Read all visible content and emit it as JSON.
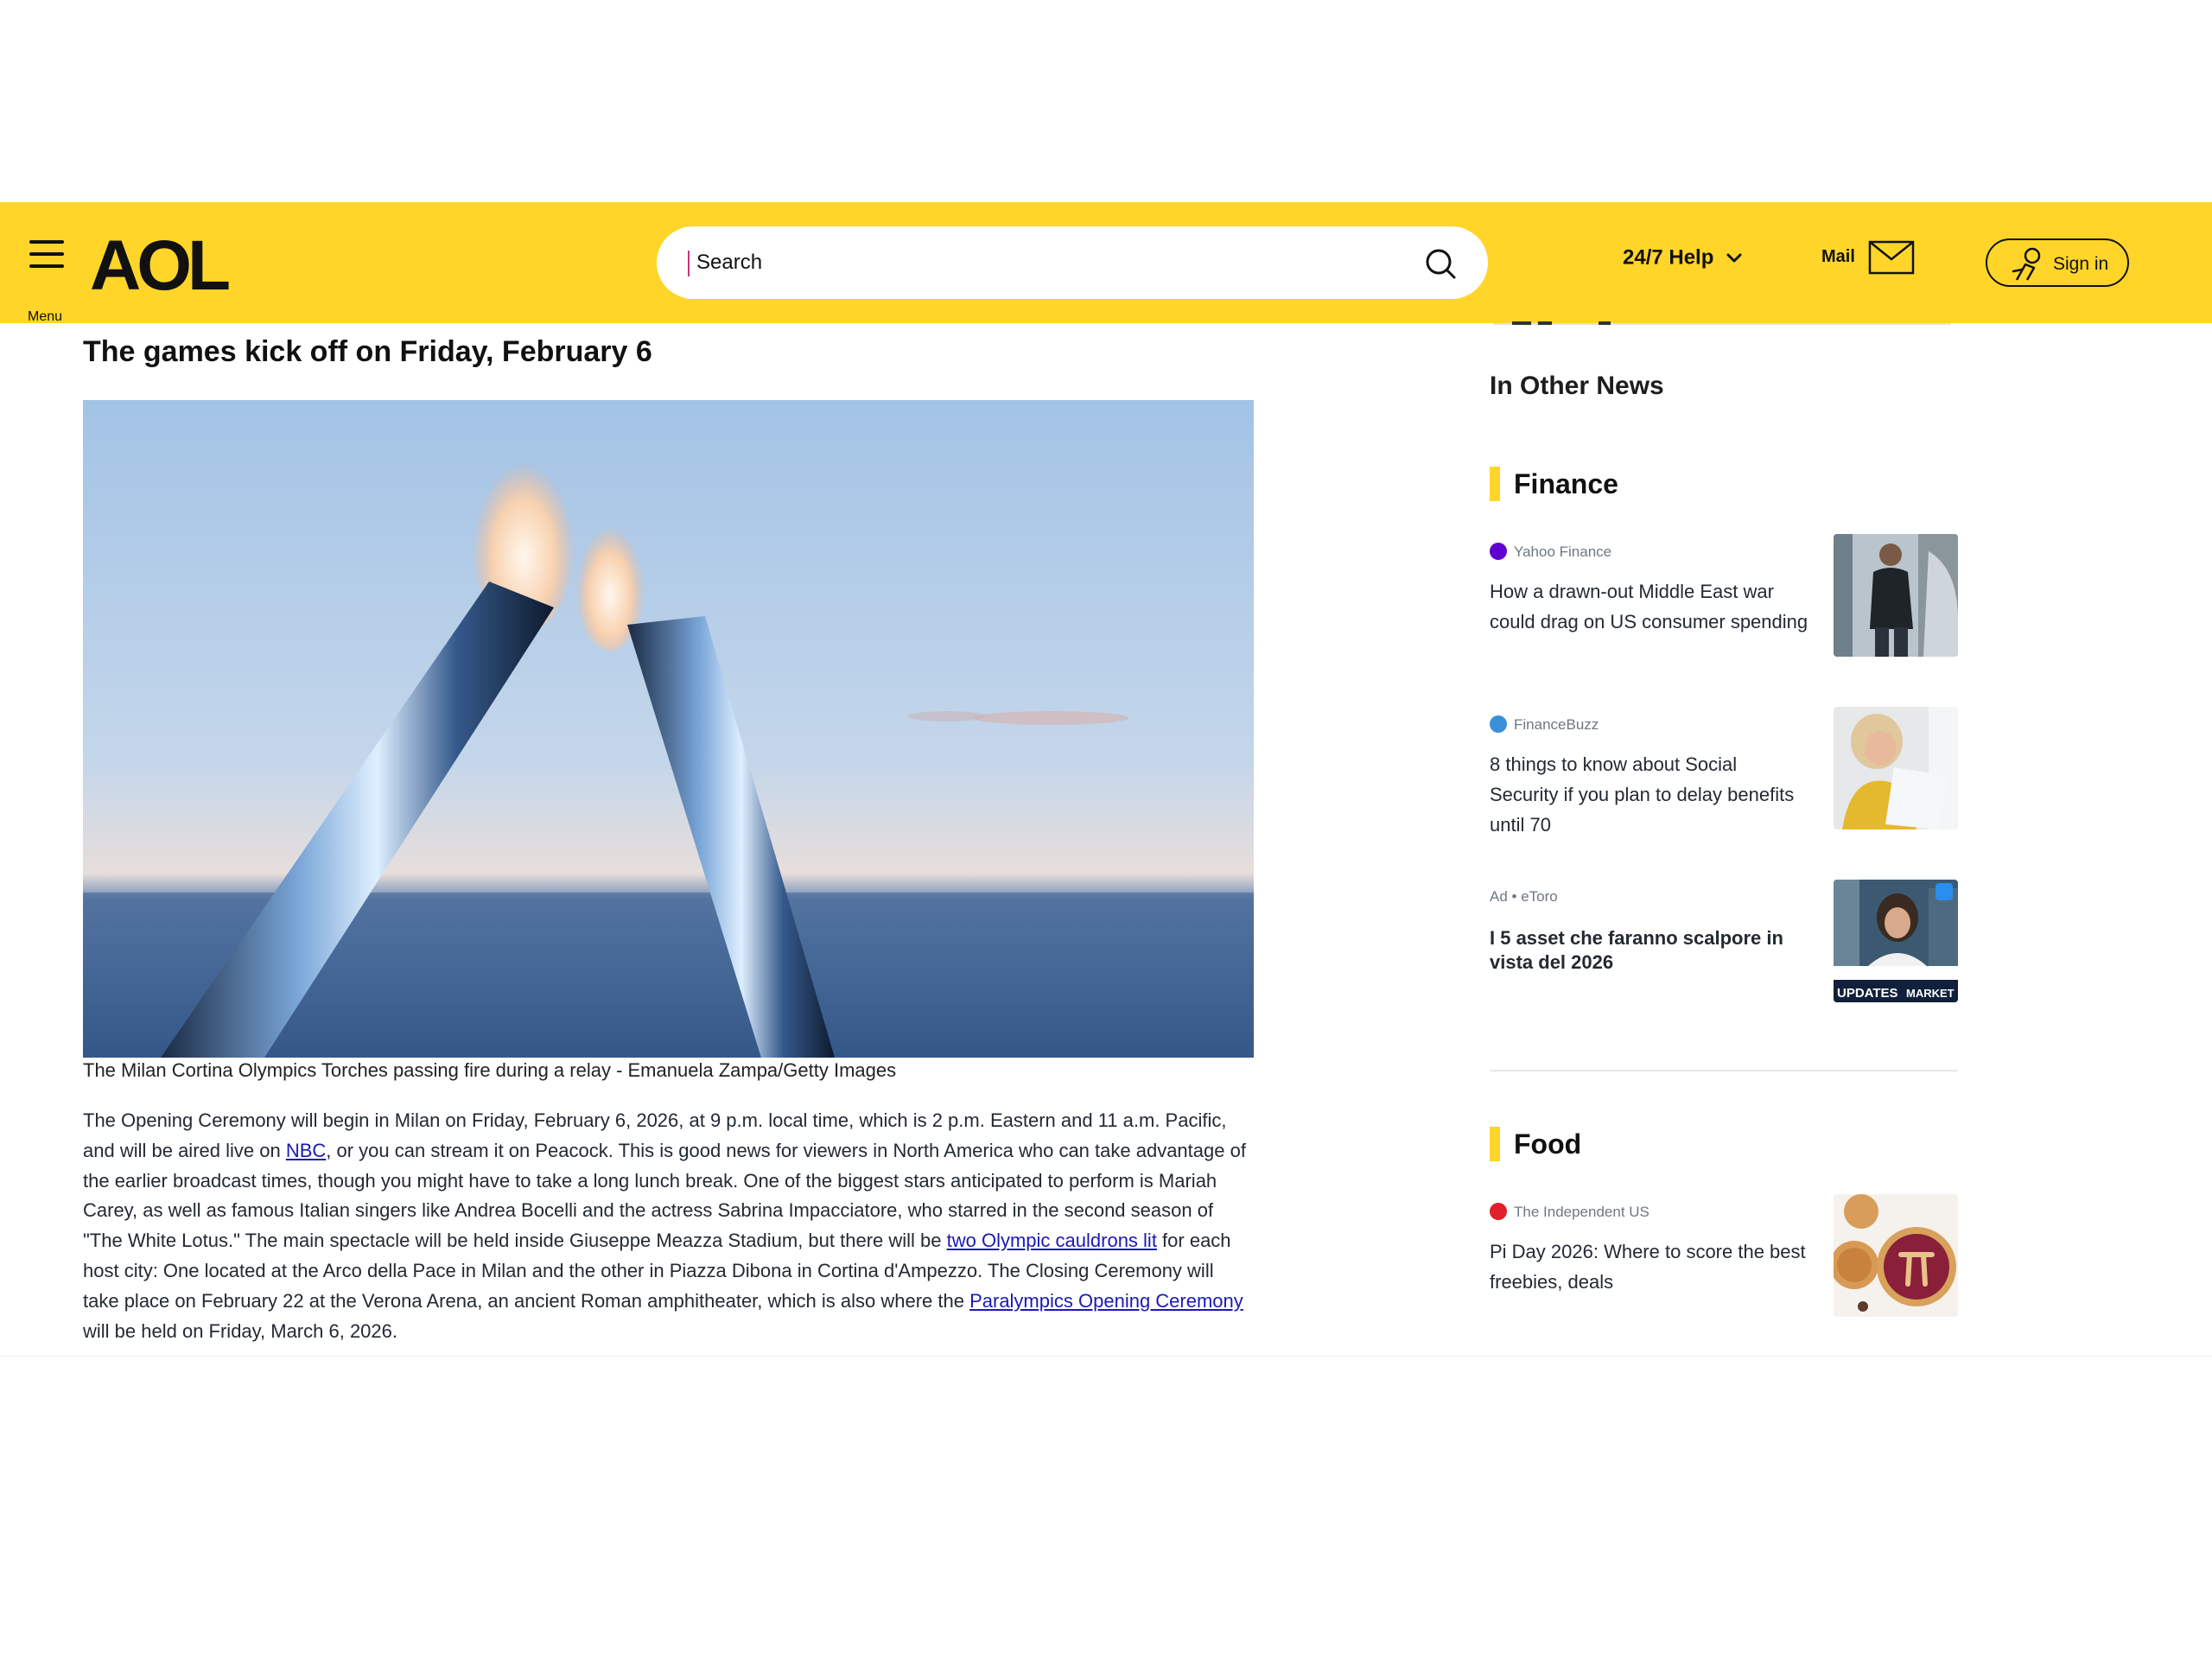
{
  "header": {
    "menu_label": "Menu",
    "logo": "AOL",
    "search_placeholder": "Search",
    "help_label": "24/7 Help",
    "mail_label": "Mail",
    "signin_label": "Sign in",
    "brand_color": "#ffd52a"
  },
  "article": {
    "heading": "The games kick off on Friday, February 6",
    "caption": "The Milan Cortina Olympics Torches passing fire during a relay - Emanuela Zampa/Getty Images",
    "p1": "The Opening Ceremony will begin in Milan on Friday, February 6, 2026, at 9 p.m. local time, which is 2 p.m. Eastern and 11 a.m. Pacific, and will be aired live on ",
    "link_nbc": "NBC",
    "p2": ", or you can stream it on Peacock. This is good news for viewers in North America who can take advantage of the earlier broadcast times, though you might have to take a long lunch break. One of the biggest stars anticipated to perform is Mariah Carey, as well as famous Italian singers like Andrea Bocelli and the actress Sabrina Impacciatore, who starred in the second season of \"The White Lotus.\" The main spectacle will be held inside Giuseppe Meazza Stadium, but there will be ",
    "link_cauldrons": "two Olympic cauldrons lit",
    "p3": " for each host city: One located at the Arco della Pace in Milan and the other in Piazza Dibona in Cortina d'Ampezzo. The Closing Ceremony will take place on February 22 at the Verona Arena, an ancient Roman amphitheater, which is also where the ",
    "link_paralympics": "Paralympics Opening Ceremony",
    "p4": " will be held on Friday, March 6, 2026."
  },
  "sidebar": {
    "heading": "In Other News",
    "sections": [
      {
        "title": "Finance",
        "items": [
          {
            "source": "Yahoo Finance",
            "source_color": "#6001d2",
            "title": "How a drawn-out Middle East war could drag on US consumer spending"
          },
          {
            "source": "FinanceBuzz",
            "source_color": "#3a8fd9",
            "title": "8 things to know about Social Security if you plan to delay benefits until 70"
          },
          {
            "source": "Ad • eToro",
            "title": "I 5 asset che faranno scalpore in vista del 2026",
            "thumb_text_left": "UPDATES",
            "thumb_text_right": "MARKET UP"
          }
        ]
      },
      {
        "title": "Food",
        "items": [
          {
            "source": "The Independent US",
            "source_color": "#e0202b",
            "title": "Pi Day 2026: Where to score the best freebies, deals"
          }
        ]
      }
    ]
  }
}
